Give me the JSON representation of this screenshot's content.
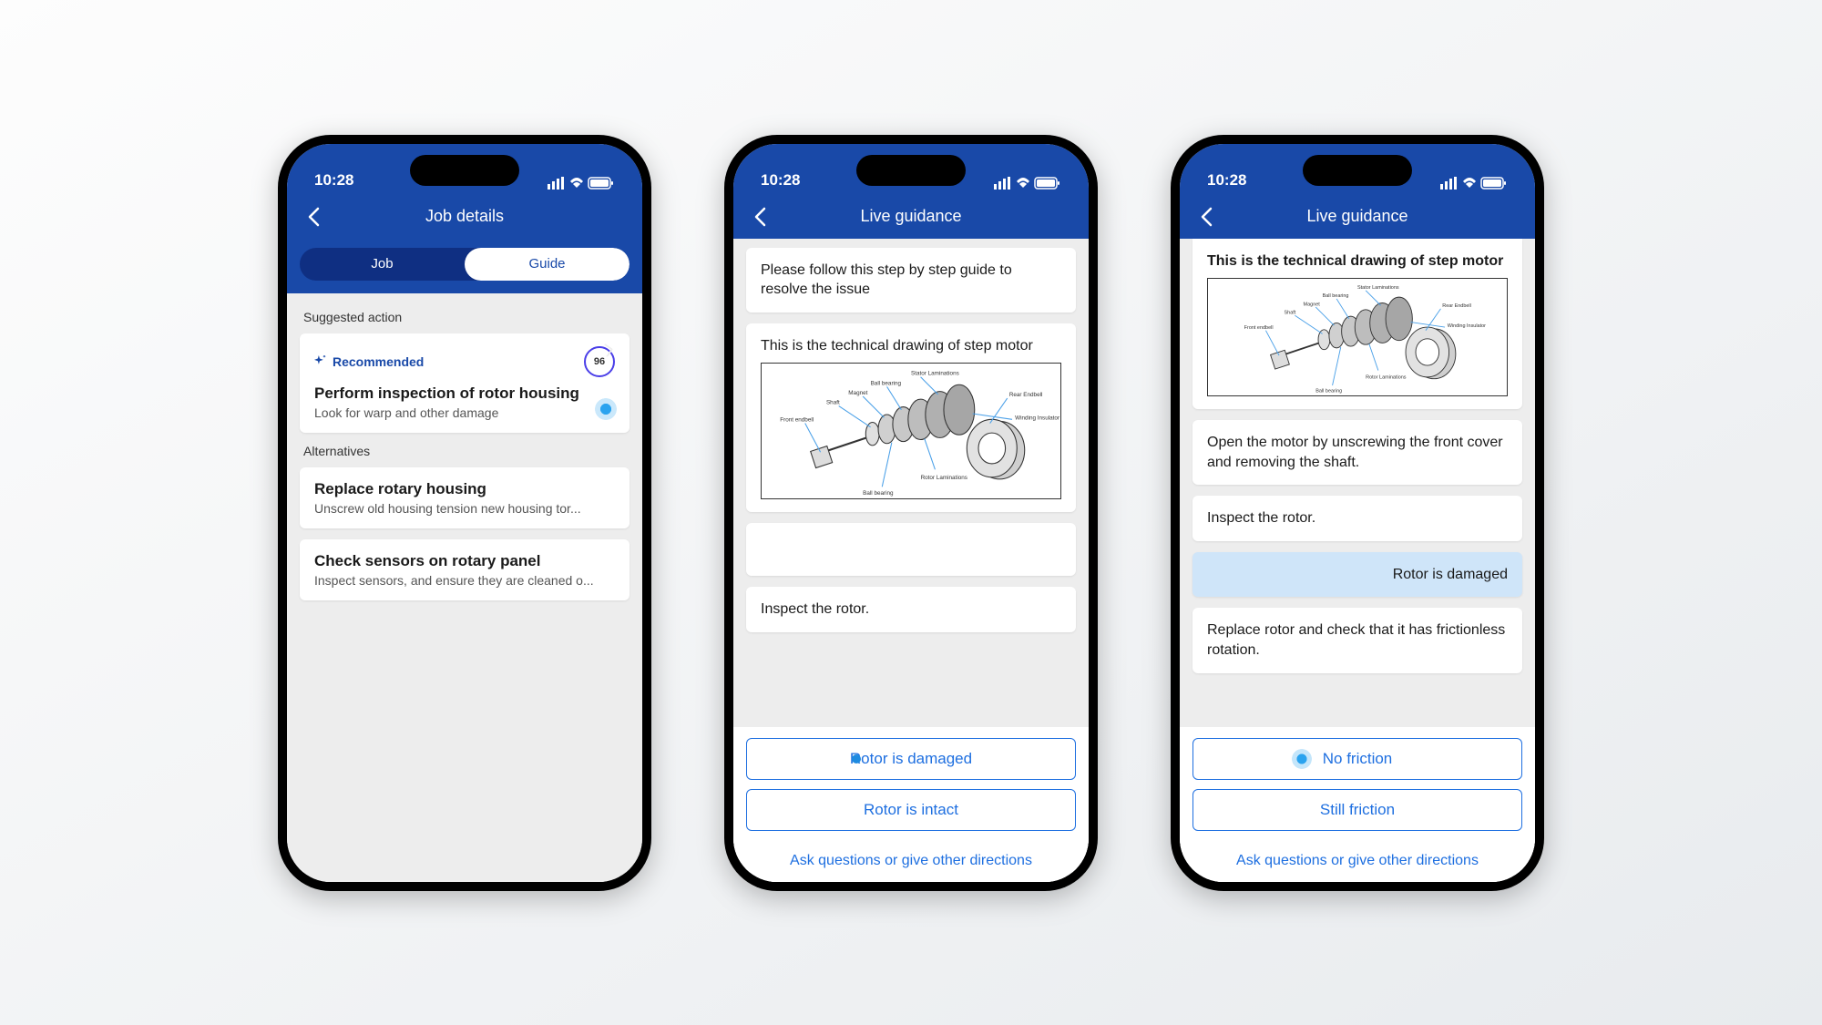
{
  "status": {
    "time": "10:28"
  },
  "phone1": {
    "title": "Job details",
    "tab_job": "Job",
    "tab_guide": "Guide",
    "section_suggested": "Suggested action",
    "recommended_badge": "Recommended",
    "score": "96",
    "rec_title": "Perform inspection of rotor housing",
    "rec_sub": "Look for warp and other damage",
    "section_alt": "Alternatives",
    "alt1_title": "Replace rotary housing",
    "alt1_sub": "Unscrew old housing tension new housing tor...",
    "alt2_title": "Check sensors on rotary panel",
    "alt2_sub": "Inspect sensors, and ensure they are cleaned o..."
  },
  "phone2": {
    "title": "Live guidance",
    "card_intro": "Please follow this step by step guide to resolve the issue",
    "card_drawing": "This is the technical drawing of step motor",
    "card_inspect": "Inspect the rotor.",
    "btn1": "Rotor is damaged",
    "btn2": "Rotor is intact",
    "link": "Ask questions or give other directions"
  },
  "phone3": {
    "title": "Live guidance",
    "card_drawing": "This is the technical drawing of step motor",
    "card_open": "Open the motor by unscrewing the front cover and removing the shaft.",
    "card_inspect": "Inspect the rotor.",
    "card_response": "Rotor is damaged",
    "card_replace": "Replace rotor and check that it has frictionless rotation.",
    "btn1": "No friction",
    "btn2": "Still friction",
    "link": "Ask questions or give other directions"
  },
  "drawing_labels": {
    "stator": "Stator Laminations",
    "ball": "Ball bearing",
    "magnet": "Magnet",
    "shaft": "Shaft",
    "front": "Front endbell",
    "rear": "Rear Endbell",
    "winding": "Winding Insulator",
    "rotor": "Rotor Laminations"
  }
}
